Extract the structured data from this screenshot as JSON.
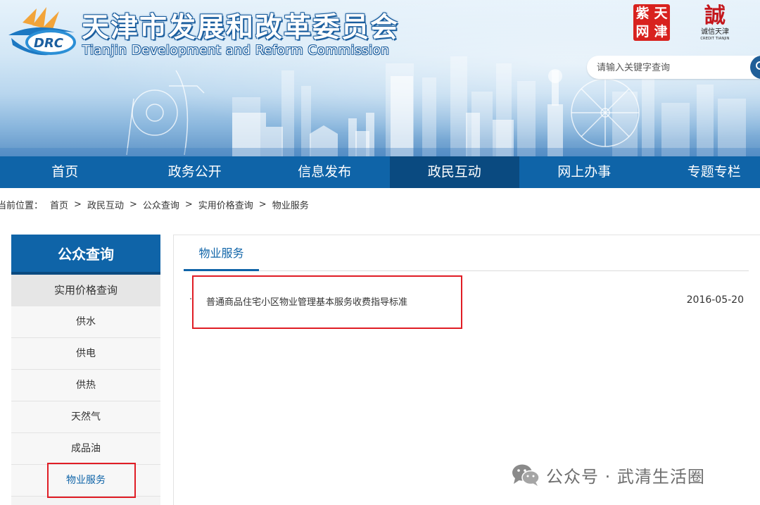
{
  "header": {
    "title": "天津市发展和改革委员会",
    "subtitle": "Tianjin Development and Reform Commission",
    "logo_text": "DRC",
    "seal_chars": [
      "天",
      "津",
      "紫",
      "网"
    ],
    "credit_logo": {
      "mark": "誠",
      "script": "诚信天津",
      "en": "CREDIT TIANJIN"
    },
    "search": {
      "placeholder": "请输入关键字查询",
      "button_icon": "search-icon"
    },
    "colors": {
      "primary": "#0f64a8",
      "nav_active": "#0a4a80",
      "highlight": "#e01d25"
    }
  },
  "nav": {
    "items": [
      {
        "label": "首页"
      },
      {
        "label": "政务公开"
      },
      {
        "label": "信息发布"
      },
      {
        "label": "政民互动",
        "active": true
      },
      {
        "label": "网上办事"
      },
      {
        "label": "专题专栏"
      }
    ]
  },
  "breadcrumb": {
    "prefix": "当前位置：",
    "items": [
      "首页",
      "政民互动",
      "公众查询",
      "实用价格查询",
      "物业服务"
    ],
    "separator": ">"
  },
  "sidebar": {
    "title": "公众查询",
    "category": "实用价格查询",
    "items": [
      {
        "label": "供水"
      },
      {
        "label": "供电"
      },
      {
        "label": "供热"
      },
      {
        "label": "天然气"
      },
      {
        "label": "成品油"
      },
      {
        "label": "物业服务",
        "active": true
      }
    ]
  },
  "main": {
    "tab": "物业服务",
    "list": [
      {
        "bullet": "·",
        "title": "普通商品住宅小区物业管理基本服务收费指导标准",
        "date": "2016-05-20"
      }
    ]
  },
  "watermark": {
    "text": "公众号 · 武清生活圈",
    "icon": "wechat-icon"
  }
}
